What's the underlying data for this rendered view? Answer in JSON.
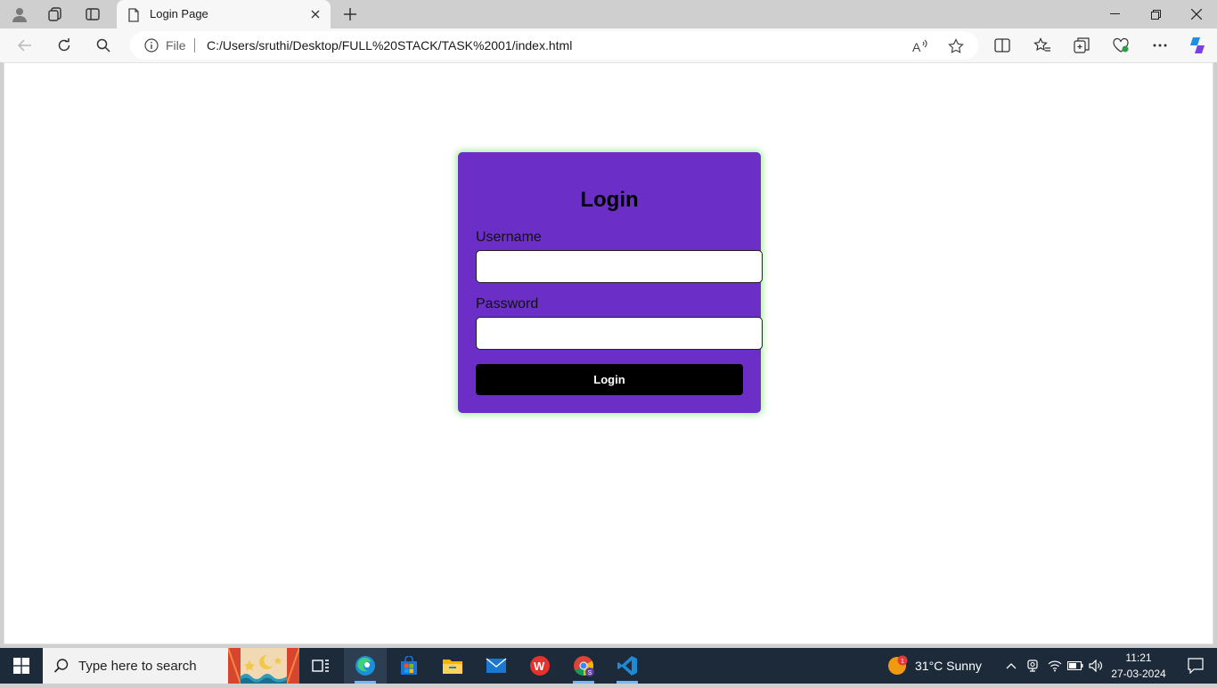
{
  "browser": {
    "tab_title": "Login Page",
    "address_scheme_label": "File",
    "address_url": "C:/Users/sruthi/Desktop/FULL%20STACK/TASK%2001/index.html"
  },
  "page": {
    "login_title": "Login",
    "username_label": "Username",
    "username_value": "",
    "password_label": "Password",
    "password_value": "",
    "login_button_label": "Login",
    "card_color": "#6b2fc7"
  },
  "taskbar": {
    "search_placeholder": "Type here to search",
    "weather_badge": "1",
    "weather_text": "31°C  Sunny",
    "time": "11:21",
    "date": "27-03-2024",
    "chrome_badge": "S"
  }
}
